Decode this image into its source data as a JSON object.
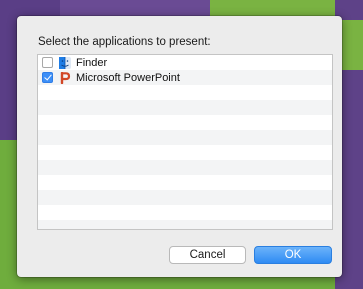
{
  "dialog": {
    "prompt": "Select the applications to present:",
    "apps": [
      {
        "name": "Finder",
        "checked": false,
        "icon": "finder-icon"
      },
      {
        "name": "Microsoft PowerPoint",
        "checked": true,
        "icon": "powerpoint-icon"
      }
    ],
    "buttons": {
      "cancel": "Cancel",
      "ok": "OK"
    }
  },
  "colors": {
    "accent": "#3d8ff7",
    "powerpoint": "#d24726",
    "finder_blue": "#1e7de6"
  }
}
